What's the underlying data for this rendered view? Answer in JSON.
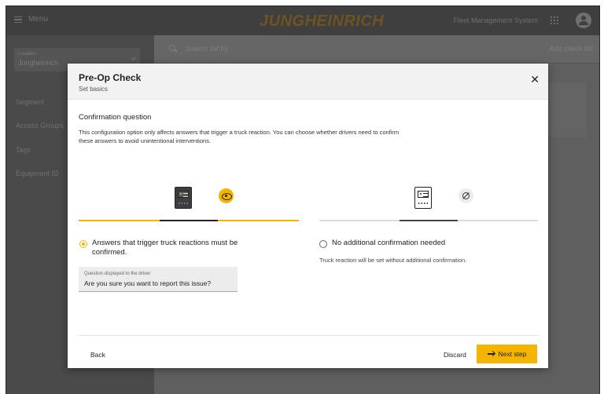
{
  "topbar": {
    "menu_label": "Menu",
    "brand": "JUNGHEINRICH",
    "fleet_label": "Fleet Management System",
    "grid_icon": "apps-grid-icon",
    "avatar_icon": "user-avatar-icon"
  },
  "sidebar": {
    "location_label": "Location",
    "location_value": "Jungheinrich",
    "items": [
      {
        "label": "Segment"
      },
      {
        "label": "Access Groups"
      },
      {
        "label": "Tags"
      },
      {
        "label": "Equipment ID"
      }
    ]
  },
  "content": {
    "search_placeholder": "Search list by",
    "add_label": "Add check list"
  },
  "modal": {
    "title": "Pre-Op Check",
    "subtitle": "Set basics",
    "section_title": "Confirmation question",
    "section_desc": "This configuration option only affects answers that trigger a truck reaction. You can choose whether drivers need to confirm these answers to avoid unintentional interventions.",
    "option_a": {
      "label": "Answers that trigger truck reactions must be confirmed.",
      "selected": true,
      "icon": "eye-icon"
    },
    "option_b": {
      "label": "No additional confirmation needed",
      "desc": "Truck reaction will be set without additional confirmation.",
      "selected": false,
      "icon": "no-entry-icon"
    },
    "question_field": {
      "label": "Question displayed to the driver",
      "value": "Are you sure you want to report this issue?"
    },
    "footer": {
      "back_label": "Back",
      "discard_label": "Discard",
      "next_label": "Next step"
    }
  },
  "colors": {
    "accent": "#f5b400",
    "overlay_dark": "#3f3f3f"
  }
}
